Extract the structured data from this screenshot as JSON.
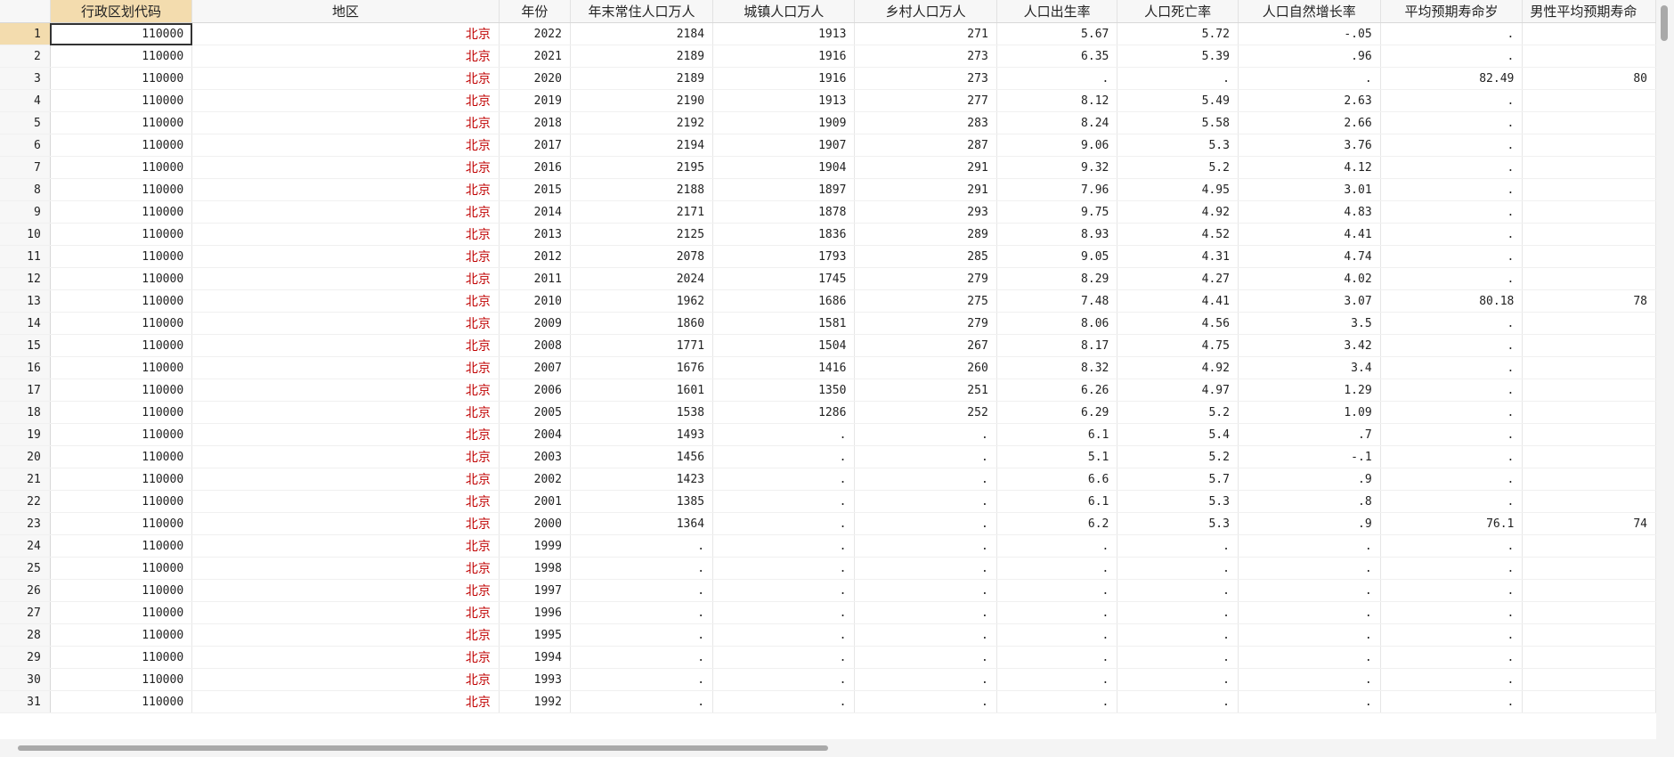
{
  "columns": [
    "行政区划代码",
    "地区",
    "年份",
    "年末常住人口万人",
    "城镇人口万人",
    "乡村人口万人",
    "人口出生率",
    "人口死亡率",
    "人口自然增长率",
    "平均预期寿命岁",
    "男性平均预期寿命"
  ],
  "rows": [
    [
      "1",
      "110000",
      "北京",
      "2022",
      "2184",
      "1913",
      "271",
      "5.67",
      "5.72",
      "-.05",
      ".",
      ""
    ],
    [
      "2",
      "110000",
      "北京",
      "2021",
      "2189",
      "1916",
      "273",
      "6.35",
      "5.39",
      ".96",
      ".",
      ""
    ],
    [
      "3",
      "110000",
      "北京",
      "2020",
      "2189",
      "1916",
      "273",
      ".",
      ".",
      ".",
      "82.49",
      "80"
    ],
    [
      "4",
      "110000",
      "北京",
      "2019",
      "2190",
      "1913",
      "277",
      "8.12",
      "5.49",
      "2.63",
      ".",
      ""
    ],
    [
      "5",
      "110000",
      "北京",
      "2018",
      "2192",
      "1909",
      "283",
      "8.24",
      "5.58",
      "2.66",
      ".",
      ""
    ],
    [
      "6",
      "110000",
      "北京",
      "2017",
      "2194",
      "1907",
      "287",
      "9.06",
      "5.3",
      "3.76",
      ".",
      ""
    ],
    [
      "7",
      "110000",
      "北京",
      "2016",
      "2195",
      "1904",
      "291",
      "9.32",
      "5.2",
      "4.12",
      ".",
      ""
    ],
    [
      "8",
      "110000",
      "北京",
      "2015",
      "2188",
      "1897",
      "291",
      "7.96",
      "4.95",
      "3.01",
      ".",
      ""
    ],
    [
      "9",
      "110000",
      "北京",
      "2014",
      "2171",
      "1878",
      "293",
      "9.75",
      "4.92",
      "4.83",
      ".",
      ""
    ],
    [
      "10",
      "110000",
      "北京",
      "2013",
      "2125",
      "1836",
      "289",
      "8.93",
      "4.52",
      "4.41",
      ".",
      ""
    ],
    [
      "11",
      "110000",
      "北京",
      "2012",
      "2078",
      "1793",
      "285",
      "9.05",
      "4.31",
      "4.74",
      ".",
      ""
    ],
    [
      "12",
      "110000",
      "北京",
      "2011",
      "2024",
      "1745",
      "279",
      "8.29",
      "4.27",
      "4.02",
      ".",
      ""
    ],
    [
      "13",
      "110000",
      "北京",
      "2010",
      "1962",
      "1686",
      "275",
      "7.48",
      "4.41",
      "3.07",
      "80.18",
      "78"
    ],
    [
      "14",
      "110000",
      "北京",
      "2009",
      "1860",
      "1581",
      "279",
      "8.06",
      "4.56",
      "3.5",
      ".",
      ""
    ],
    [
      "15",
      "110000",
      "北京",
      "2008",
      "1771",
      "1504",
      "267",
      "8.17",
      "4.75",
      "3.42",
      ".",
      ""
    ],
    [
      "16",
      "110000",
      "北京",
      "2007",
      "1676",
      "1416",
      "260",
      "8.32",
      "4.92",
      "3.4",
      ".",
      ""
    ],
    [
      "17",
      "110000",
      "北京",
      "2006",
      "1601",
      "1350",
      "251",
      "6.26",
      "4.97",
      "1.29",
      ".",
      ""
    ],
    [
      "18",
      "110000",
      "北京",
      "2005",
      "1538",
      "1286",
      "252",
      "6.29",
      "5.2",
      "1.09",
      ".",
      ""
    ],
    [
      "19",
      "110000",
      "北京",
      "2004",
      "1493",
      ".",
      ".",
      "6.1",
      "5.4",
      ".7",
      ".",
      ""
    ],
    [
      "20",
      "110000",
      "北京",
      "2003",
      "1456",
      ".",
      ".",
      "5.1",
      "5.2",
      "-.1",
      ".",
      ""
    ],
    [
      "21",
      "110000",
      "北京",
      "2002",
      "1423",
      ".",
      ".",
      "6.6",
      "5.7",
      ".9",
      ".",
      ""
    ],
    [
      "22",
      "110000",
      "北京",
      "2001",
      "1385",
      ".",
      ".",
      "6.1",
      "5.3",
      ".8",
      ".",
      ""
    ],
    [
      "23",
      "110000",
      "北京",
      "2000",
      "1364",
      ".",
      ".",
      "6.2",
      "5.3",
      ".9",
      "76.1",
      "74"
    ],
    [
      "24",
      "110000",
      "北京",
      "1999",
      ".",
      ".",
      ".",
      ".",
      ".",
      ".",
      ".",
      ""
    ],
    [
      "25",
      "110000",
      "北京",
      "1998",
      ".",
      ".",
      ".",
      ".",
      ".",
      ".",
      ".",
      ""
    ],
    [
      "26",
      "110000",
      "北京",
      "1997",
      ".",
      ".",
      ".",
      ".",
      ".",
      ".",
      ".",
      ""
    ],
    [
      "27",
      "110000",
      "北京",
      "1996",
      ".",
      ".",
      ".",
      ".",
      ".",
      ".",
      ".",
      ""
    ],
    [
      "28",
      "110000",
      "北京",
      "1995",
      ".",
      ".",
      ".",
      ".",
      ".",
      ".",
      ".",
      ""
    ],
    [
      "29",
      "110000",
      "北京",
      "1994",
      ".",
      ".",
      ".",
      ".",
      ".",
      ".",
      ".",
      ""
    ],
    [
      "30",
      "110000",
      "北京",
      "1993",
      ".",
      ".",
      ".",
      ".",
      ".",
      ".",
      ".",
      ""
    ],
    [
      "31",
      "110000",
      "北京",
      "1992",
      ".",
      ".",
      ".",
      ".",
      ".",
      ".",
      ".",
      ""
    ]
  ]
}
